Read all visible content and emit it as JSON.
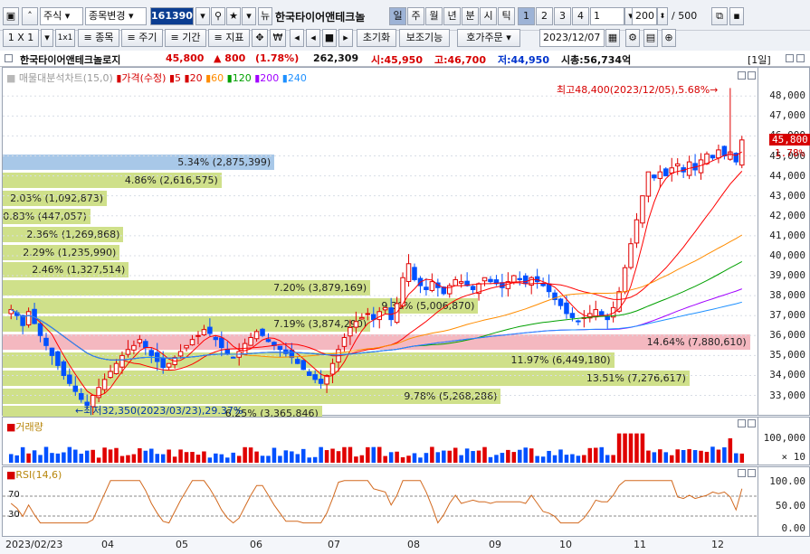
{
  "toolbar1": {
    "market": "주식",
    "type": "종목변경",
    "code": "161390",
    "stock_name": "한국타이어앤테크놀",
    "periods": [
      "일",
      "주",
      "월",
      "년",
      "분",
      "시",
      "틱"
    ],
    "numbers": [
      "1",
      "2",
      "3",
      "4"
    ],
    "interval": "1",
    "count": "200",
    "total": "/ 500"
  },
  "toolbar2": {
    "scale": "1 X 1",
    "items": "≡ 종목",
    "cycle": "≡ 주기",
    "range": "≡ 기간",
    "indicator": "≡ 지표",
    "reset": "초기화",
    "aux": "보조기능",
    "order": "호가주문",
    "date": "2023/12/07"
  },
  "info": {
    "name": "한국타이어앤테크놀로지",
    "price": "45,800",
    "change": "▲ 800",
    "pct": "(1.78%)",
    "volume": "262,309",
    "open": "시:45,950",
    "high": "고:46,700",
    "low": "저:44,950",
    "mcap": "시총:56,734억",
    "period_tag": "[1일]"
  },
  "legend": {
    "vp": "매물대분석차트(15,0)",
    "price": "가격(수정)",
    "ma": [
      "5",
      "20",
      "60",
      "120",
      "200",
      "240"
    ],
    "ma_colors": [
      "#ff0000",
      "#ff0000",
      "#ff8c00",
      "#00a000",
      "#a000ff",
      "#1e90ff"
    ]
  },
  "annotations": {
    "high": "최고48,400(2023/12/05),5.68%→",
    "low": "←최저32,350(2023/03/23),29.37%"
  },
  "price_axis": [
    "48,000",
    "47,000",
    "46,000",
    "45,000",
    "44,000",
    "43,000",
    "42,000",
    "41,000",
    "40,000",
    "39,000",
    "38,000",
    "37,000",
    "36,000",
    "35,000",
    "34,000",
    "33,000"
  ],
  "current_price_tag": "45,800",
  "current_pct_tag": "1.78%",
  "volume_profile": [
    {
      "label": "5.34% (2,875,399)",
      "price": 44700,
      "width": 0.36,
      "color": "#a8c8e8"
    },
    {
      "label": "4.86% (2,616,575)",
      "price": 43800,
      "width": 0.29,
      "color": "#cfe08a"
    },
    {
      "label": "2.03% (1,092,873)",
      "price": 42900,
      "width": 0.138,
      "color": "#cfe08a"
    },
    {
      "label": "0.83% (447,057)",
      "price": 42000,
      "width": 0.116,
      "color": "#cfe08a"
    },
    {
      "label": "2.36% (1,269,868)",
      "price": 41100,
      "width": 0.16,
      "color": "#cfe08a"
    },
    {
      "label": "2.29% (1,235,990)",
      "price": 40200,
      "width": 0.155,
      "color": "#cfe08a"
    },
    {
      "label": "2.46% (1,327,514)",
      "price": 39300,
      "width": 0.167,
      "color": "#cfe08a"
    },
    {
      "label": "7.20% (3,879,169)",
      "price": 38400,
      "width": 0.487,
      "color": "#cfe08a"
    },
    {
      "label": "9.30% (5,006,870)",
      "price": 37500,
      "width": 0.63,
      "color": "#cfe08a"
    },
    {
      "label": "7.19% (3,874,290)",
      "price": 36600,
      "width": 0.487,
      "color": "#cfe08a"
    },
    {
      "label": "14.64% (7,880,610)",
      "price": 35700,
      "width": 0.99,
      "color": "#f4b8c0"
    },
    {
      "label": "11.97% (6,449,180)",
      "price": 34800,
      "width": 0.81,
      "color": "#cfe08a"
    },
    {
      "label": "13.51% (7,276,617)",
      "price": 33900,
      "width": 0.91,
      "color": "#cfe08a"
    },
    {
      "label": "9.78% (5,268,286)",
      "price": 33000,
      "width": 0.66,
      "color": "#cfe08a"
    },
    {
      "label": "6.25% (3,365,846)",
      "price": 32100,
      "width": 0.423,
      "color": "#cfe08a"
    }
  ],
  "volume_pane": {
    "title": "거래량",
    "ticks": [
      "100,000",
      "× 10"
    ]
  },
  "rsi_pane": {
    "title": "RSI(14,6)",
    "ticks": [
      "100.00",
      "50.00",
      "0.00"
    ],
    "levels": [
      "70",
      "30"
    ]
  },
  "x_labels": [
    "2023/02/23",
    "04",
    "05",
    "06",
    "07",
    "08",
    "09",
    "10",
    "11",
    "12"
  ],
  "chart_data": {
    "type": "line",
    "title": "",
    "ylim": [
      32300,
      48600
    ],
    "closes": [
      37300,
      37000,
      36500,
      37200,
      36600,
      36000,
      35500,
      35000,
      34500,
      34000,
      33600,
      33200,
      32800,
      32500,
      33000,
      33400,
      33800,
      34200,
      34600,
      35000,
      35300,
      35500,
      35800,
      35400,
      35000,
      34700,
      34400,
      34600,
      34900,
      35200,
      35500,
      35800,
      36000,
      36300,
      36100,
      35800,
      35400,
      35100,
      34900,
      35200,
      35600,
      35900,
      36200,
      36000,
      35700,
      35500,
      35300,
      35100,
      34900,
      34600,
      34300,
      34000,
      33800,
      33600,
      34000,
      34600,
      35300,
      35900,
      36400,
      36700,
      36900,
      37100,
      36800,
      37200,
      37400,
      36800,
      37600,
      38900,
      39600,
      38800,
      38500,
      38300,
      38700,
      38400,
      38100,
      38500,
      38800,
      38700,
      38500,
      38300,
      38600,
      38900,
      38700,
      38600,
      38400,
      38700,
      39000,
      38800,
      38600,
      38900,
      38700,
      38500,
      38200,
      37800,
      37500,
      37100,
      36900,
      36700,
      36900,
      37100,
      37300,
      37000,
      36800,
      37400,
      38200,
      39400,
      40600,
      41800,
      43000,
      44200,
      43900,
      44200,
      44000,
      44400,
      44600,
      44200,
      44700,
      44300,
      44800,
      45100,
      44900,
      45300,
      45000,
      45200,
      44700,
      45800
    ]
  }
}
